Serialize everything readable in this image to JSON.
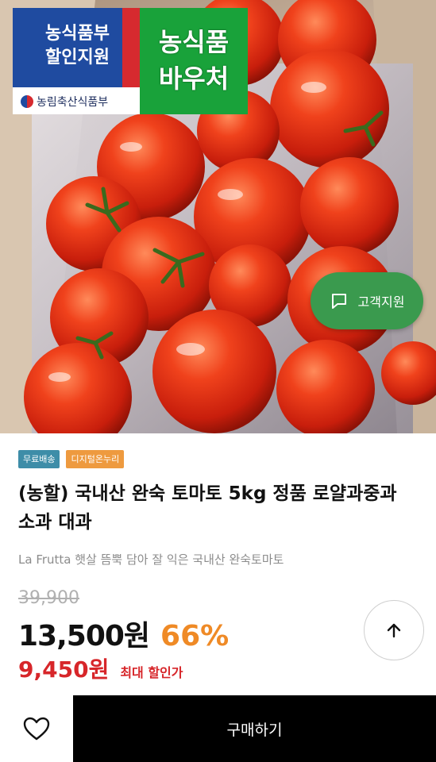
{
  "image": {
    "gov_badge_line1": "농식품부",
    "gov_badge_line2": "할인지원",
    "ministry": "농림축산식품부",
    "voucher_line1": "농식품",
    "voucher_line2": "바우처"
  },
  "support_button": {
    "label": "고객지원",
    "icon": "chat-icon"
  },
  "tags": [
    {
      "label": "무료배송",
      "color": "#3e8da8"
    },
    {
      "label": "디지털온누리",
      "color": "#ee9a3f"
    }
  ],
  "product": {
    "title": "(농할) 국내산 완숙 토마토 5kg 정품 로얄과중과 소과 대과",
    "subtitle": "La Frutta 햇살 뜸뿍 담아 잘 익은 국내산 완숙토마토",
    "original_price": "39,900",
    "price": "13,500원",
    "discount": "66%",
    "min_price": "9,450원",
    "min_price_label": "최대 할인가"
  },
  "bottom_bar": {
    "like_icon": "heart-icon",
    "buy_label": "구매하기"
  },
  "colors": {
    "accent_orange": "#ef8a26",
    "price_red": "#d7262a",
    "support_green": "#3a9a4e"
  }
}
